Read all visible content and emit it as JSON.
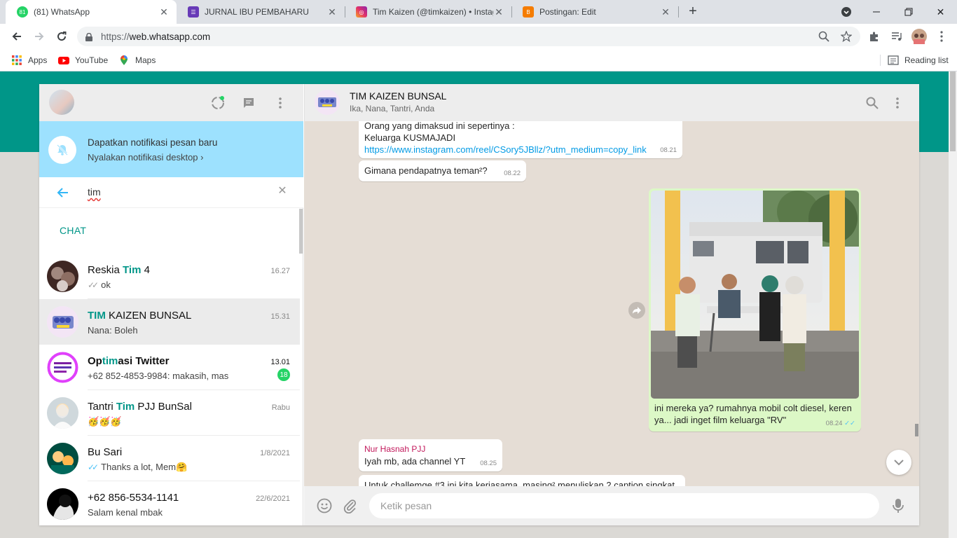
{
  "browser": {
    "tabs": [
      {
        "title": "(81) WhatsApp",
        "favicon": "whatsapp-icon",
        "badge": "81",
        "color": "#25d366"
      },
      {
        "title": "JURNAL IBU PEMBAHARU",
        "favicon": "forms-icon",
        "color": "#673ab7"
      },
      {
        "title": "Tim Kaizen (@timkaizen) • Instag",
        "favicon": "instagram-icon",
        "color": "#e1306c"
      },
      {
        "title": "Postingan: Edit",
        "favicon": "blogger-icon",
        "color": "#f57c00"
      }
    ],
    "url_scheme": "https://",
    "url_host": "web.whatsapp.com",
    "bookmarks": [
      {
        "label": "Apps",
        "icon": "apps-grid-icon"
      },
      {
        "label": "YouTube",
        "icon": "youtube-icon"
      },
      {
        "label": "Maps",
        "icon": "maps-pin-icon"
      }
    ],
    "reading_list": "Reading list"
  },
  "notification": {
    "title": "Dapatkan notifikasi pesan baru",
    "action": "Nyalakan notifikasi desktop"
  },
  "search": {
    "query": "tim"
  },
  "section_label": "CHAT",
  "chats": [
    {
      "name_parts": [
        "Reskia ",
        "Tim",
        " 4"
      ],
      "time": "16.27",
      "tick": "✓✓",
      "tick_color": "grey",
      "message": "ok",
      "bold": false
    },
    {
      "name_parts": [
        "",
        "TIM",
        " KAIZEN BUNSAL"
      ],
      "time": "15.31",
      "tick": "",
      "message": "Nana: Boleh",
      "bold": false,
      "selected": true
    },
    {
      "name_parts": [
        "Op",
        "tim",
        "asi Twitter"
      ],
      "time": "13.01",
      "tick": "",
      "message": "+62 852-4853-9984: makasih, mas",
      "bold": true,
      "unread": "18"
    },
    {
      "name_parts": [
        "Tantri ",
        "Tim",
        " PJJ BunSal"
      ],
      "time": "Rabu",
      "tick": "",
      "message": "🥳🥳🥳",
      "bold": false
    },
    {
      "name_parts": [
        "Bu Sari",
        "",
        ""
      ],
      "time": "1/8/2021",
      "tick": "✓✓",
      "tick_color": "blue",
      "message": "Thanks a lot, Mem🤗",
      "bold": false
    },
    {
      "name_parts": [
        "+62 856-5534-1141",
        "",
        ""
      ],
      "time": "22/6/2021",
      "tick": "",
      "message": "Salam kenal mbak",
      "bold": false
    }
  ],
  "conversation": {
    "name": "TIM KAIZEN BUNSAL",
    "members": "Ika, Nana, Tantri, Anda",
    "messages": [
      {
        "lines": [
          "Orang yang dimaksud ini sepertinya :",
          "Keluarga KUSMAJADI"
        ],
        "link": "https://www.instagram.com/reel/CSory5JBllz/?utm_medium=copy_link",
        "time": "08.21"
      },
      {
        "text": "Gimana pendapatnya teman²?",
        "time": "08.22"
      },
      {
        "caption": "ini mereka ya? rumahnya mobil colt diesel, keren ya... jadi inget film keluarga \"RV\"",
        "time": "08.24",
        "tick": "✓✓"
      },
      {
        "sender": "Nur Hasnah PJJ",
        "text": "Iyah mb, ada channel YT",
        "time": "08.25"
      },
      {
        "text": "Untuk challemge #3 ini kita kerjasama, masing² menuliskan 2 caption singkat"
      }
    ]
  },
  "composer": {
    "placeholder": "Ketik pesan"
  },
  "colors": {
    "brand": "#009688",
    "unread": "#25d366",
    "outgoing": "#dcf8c6",
    "notif": "#9de1fe"
  }
}
